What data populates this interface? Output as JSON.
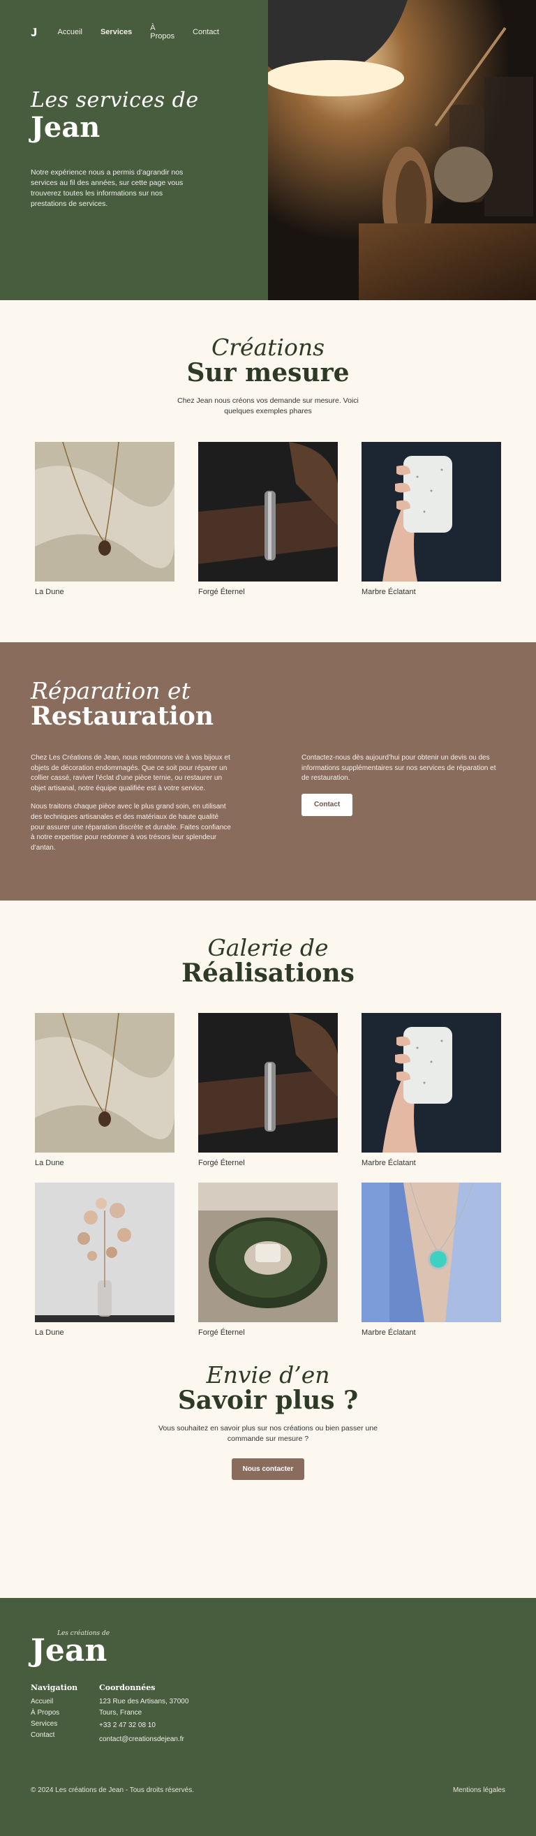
{
  "nav": {
    "items": [
      "Accueil",
      "Services",
      "À Propos",
      "Contact"
    ],
    "active": "Services"
  },
  "hero": {
    "title_script": "Les services de",
    "title_display": "Jean",
    "text": "Notre expérience nous a permis d’agrandir nos services au fil des années, sur cette page vous trouverez toutes les informations sur nos prestations de services."
  },
  "creations": {
    "title_script": "Créations",
    "title_display": "Sur mesure",
    "subtitle": "Chez Jean nous créons vos demande sur mesure. Voici quelques exemples phares",
    "items": [
      {
        "caption": "La Dune",
        "image": "necklace-on-fabric"
      },
      {
        "caption": "Forgé Éternel",
        "image": "bracelet-on-wrist"
      },
      {
        "caption": "Marbre Éclatant",
        "image": "soap-bar-in-hand"
      }
    ]
  },
  "repair": {
    "title_script": "Réparation et",
    "title_display": "Restauration",
    "p1": "Chez Les Créations de Jean, nous redonnons vie à vos bijoux et objets de décoration endommagés. Que ce soit pour réparer un collier cassé, raviver l’éclat d’une pièce ternie, ou restaurer un objet artisanal, notre équipe qualifiée est à votre service.",
    "p2": "Nous traitons chaque pièce avec le plus grand soin, en utilisant des techniques artisanales et des matériaux de haute qualité pour assurer une réparation discrète et durable. Faites confiance à notre expertise pour redonner à vos trésors leur splendeur d’antan.",
    "contact_text": "Contactez-nous dès aujourd’hui pour obtenir un devis ou des informations supplémentaires sur nos services de réparation et de restauration.",
    "button": "Contact"
  },
  "gallery": {
    "title_script": "Galerie de",
    "title_display": "Réalisations",
    "row1": [
      {
        "caption": "La Dune",
        "image": "necklace-on-fabric"
      },
      {
        "caption": "Forgé Éternel",
        "image": "bracelet-on-wrist"
      },
      {
        "caption": "Marbre Éclatant",
        "image": "soap-bar-in-hand"
      }
    ],
    "row2": [
      {
        "caption": "La Dune",
        "image": "dried-flowers-vase"
      },
      {
        "caption": "Forgé Éternel",
        "image": "pine-wreath-candle"
      },
      {
        "caption": "Marbre Éclatant",
        "image": "turquoise-pendant"
      }
    ]
  },
  "cta": {
    "title_script": "Envie d’en",
    "title_display": "Savoir plus ?",
    "text": "Vous souhaitez en savoir plus sur nos créations ou bien passer une commande sur mesure ?",
    "button": "Nous contacter"
  },
  "footer": {
    "logo_small": "Les créations de",
    "logo_big": "Jean",
    "nav_title": "Navigation",
    "nav_links": [
      "Accueil",
      "À Propos",
      "Services",
      "Contact"
    ],
    "coords_title": "Coordonnées",
    "address1": "123 Rue des Artisans, 37000",
    "address2": "Tours, France",
    "phone": "+33 2 47 32 08 10",
    "email": "contact@creationsdejean.fr",
    "copyright": "© 2024 Les créations de Jean - Tous droits réservés.",
    "legal": "Mentions légales"
  },
  "colors": {
    "green": "#485d3d",
    "brown": "#8a6c5c",
    "cream": "#fcf8ef",
    "dark_green_text": "#2d3a25"
  }
}
